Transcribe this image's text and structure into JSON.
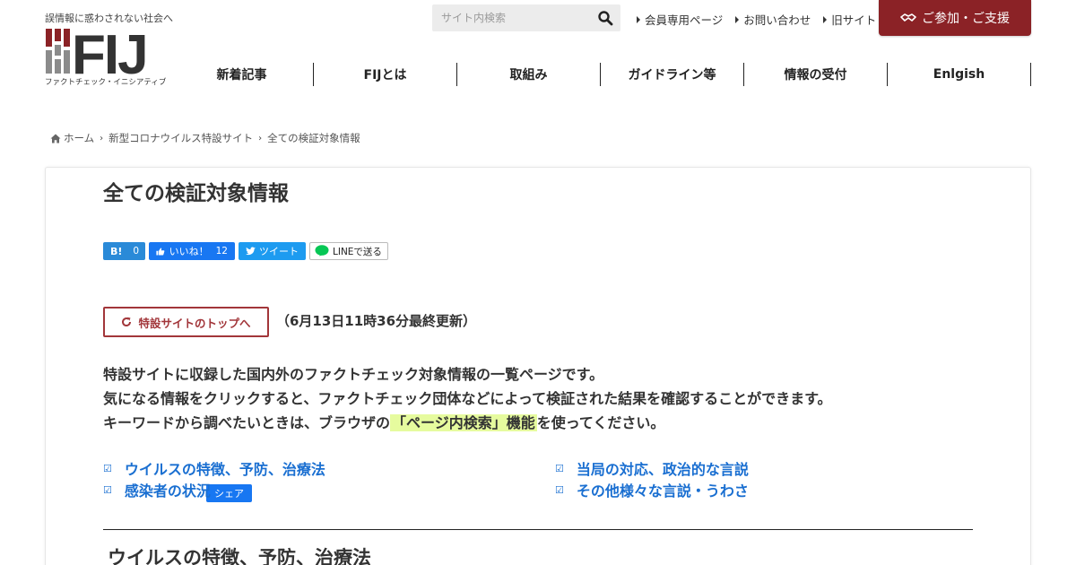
{
  "header": {
    "tagline": "誤情報に惑わされない社会へ",
    "logo_text": "FIJ",
    "logo_subtitle": "ファクトチェック・イニシアティブ",
    "search_placeholder": "サイト内検索",
    "util_links": [
      "会員専用ページ",
      "お問い合わせ",
      "旧サイト"
    ],
    "join_button": "ご参加・ご支援",
    "brand_color": "#8b2226"
  },
  "nav": {
    "items": [
      "新着記事",
      "FIJとは",
      "取組み",
      "ガイドライン等",
      "情報の受付",
      "Enlgish"
    ]
  },
  "breadcrumb": {
    "home": "ホーム",
    "items": [
      "新型コロナウイルス特設サイト",
      "全ての検証対象情報"
    ]
  },
  "main": {
    "title": "全ての検証対象情報",
    "share": {
      "hatena_label": "B!",
      "hatena_count": "0",
      "fb_like_label": "いいね！",
      "fb_like_count": "12",
      "fb_share_label": "シェア",
      "tweet_label": "ツイート",
      "line_label": "LINEで送る"
    },
    "top_button": "特設サイトのトップへ",
    "updated": "（6月13日11時36分最終更新）",
    "intro": {
      "line1": "特設サイトに収録した国内外のファクトチェック対象情報の一覧ページです。",
      "line2": "気になる情報をクリックすると、ファクトチェック団体などによって検証された結果を確認することができます。",
      "line3_before": "キーワードから調べたいときは、ブラウザの",
      "line3_highlight": "「ページ内検索」機能",
      "line3_after": "を使ってください。"
    },
    "toc": [
      "ウイルスの特徴、予防、治療法",
      "当局の対応、政治的な言説",
      "感染者の状況",
      "その他様々な言説・うわさ"
    ],
    "toc_check": "☑",
    "section_heading": "ウイルスの特徴、予防、治療法"
  }
}
